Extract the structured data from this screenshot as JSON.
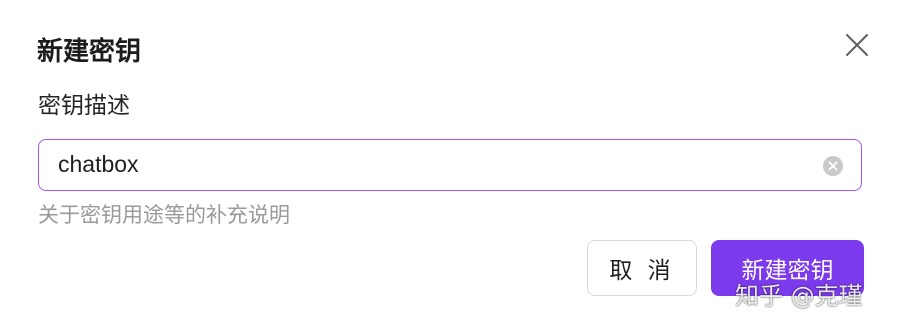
{
  "dialog": {
    "title": "新建密钥",
    "close_icon": "close-icon"
  },
  "field": {
    "label": "密钥描述",
    "value": "chatbox",
    "clear_icon": "clear-circle-icon",
    "helper": "关于密钥用途等的补充说明"
  },
  "buttons": {
    "cancel_label": "取 消",
    "create_label": "新建密钥"
  },
  "watermark": {
    "text": "知乎 @克瑾"
  },
  "colors": {
    "accent": "#7c3aed",
    "input_border": "#a855f7",
    "helper_text": "#9a9a9a"
  }
}
